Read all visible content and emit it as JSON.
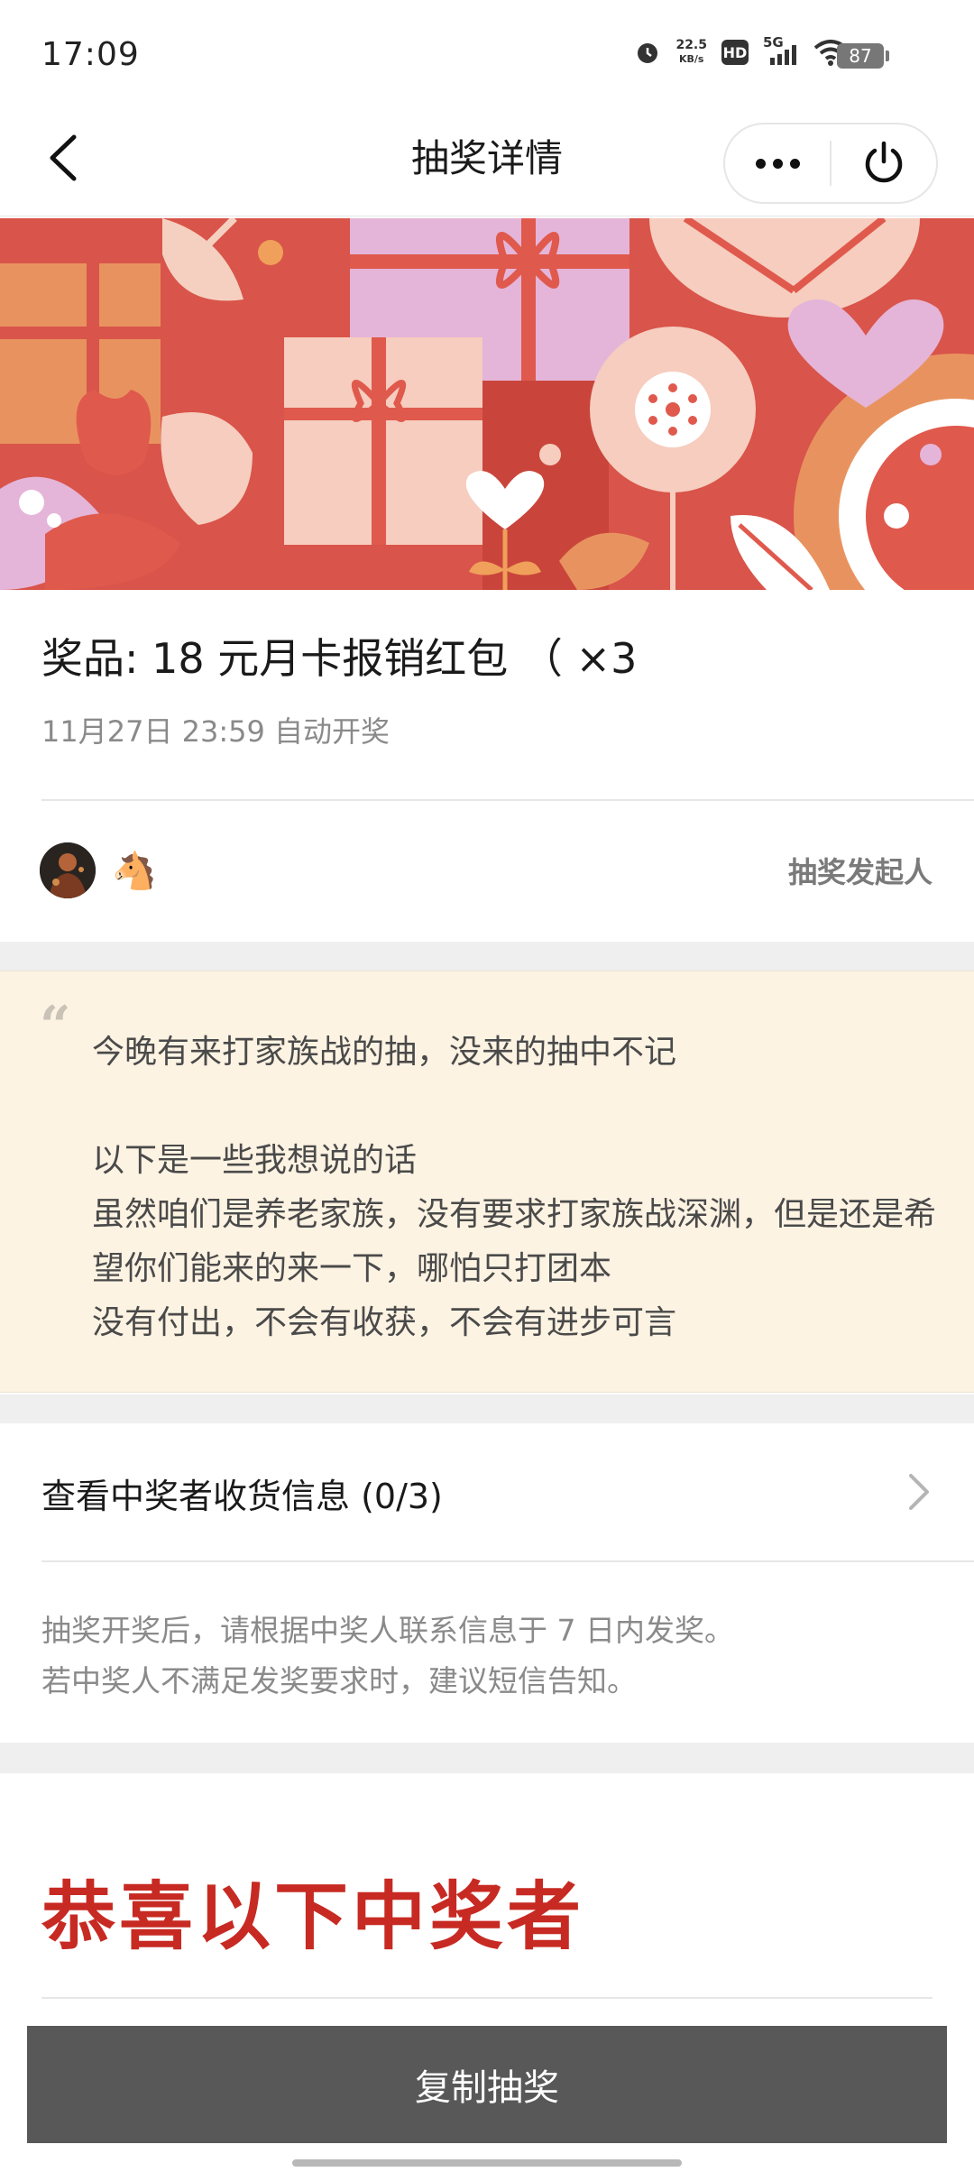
{
  "status_bar": {
    "time": "17:09",
    "network_speed_value": "22.5",
    "network_speed_unit": "KB/s",
    "hd_label": "HD",
    "signal_label": "5G",
    "battery": "87"
  },
  "nav": {
    "title": "抽奖详情"
  },
  "prize": {
    "title": "奖品: 18 元月卡报销红包 （ ×3",
    "draw_time": "11月27日 23:59 自动开奖"
  },
  "initiator": {
    "nickname_emoji": "🐴",
    "label": "抽奖发起人"
  },
  "message": {
    "lines": [
      "今晚有来打家族战的抽，没来的抽中不记",
      "",
      "以下是一些我想说的话",
      "虽然咱们是养老家族，没有要求打家族战深渊，但是还是希望你们能来的来一下，哪怕只打团本",
      "没有付出，不会有收获，不会有进步可言"
    ]
  },
  "winner_info": {
    "label": "查看中奖者收货信息 (0/3)"
  },
  "notes": {
    "line1": "抽奖开奖后，请根据中奖人联系信息于 7 日内发奖。",
    "line2": "若中奖人不满足发奖要求时，建议短信告知。"
  },
  "congrats": {
    "title": "恭喜以下中奖者"
  },
  "bottom": {
    "button_label": "复制抽奖"
  },
  "colors": {
    "accent_red": "#c72a22",
    "banner_red": "#d9544a",
    "quote_bg": "#fdf3e3",
    "button_bg": "#585858"
  }
}
